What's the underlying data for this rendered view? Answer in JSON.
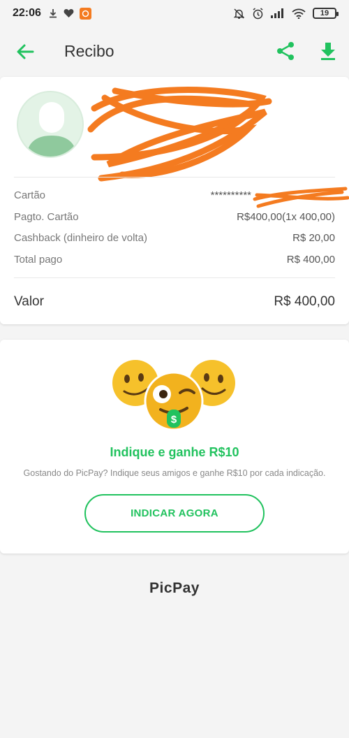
{
  "status_bar": {
    "time": "22:06",
    "battery": "19",
    "left_icons": [
      "download-icon",
      "heart-icon",
      "app-notification-icon"
    ],
    "right_icons": [
      "bell-off-icon",
      "alarm-icon",
      "signal-icon",
      "wifi-icon",
      "battery-icon"
    ]
  },
  "app_bar": {
    "title": "Recibo",
    "accent_color": "#21c25e"
  },
  "receipt": {
    "rows": [
      {
        "label": "Cartão",
        "value": "**********"
      },
      {
        "label": "Pagto. Cartão",
        "value": "R$400,00(1x 400,00)"
      },
      {
        "label": "Cashback (dinheiro de volta)",
        "value": "R$ 20,00"
      },
      {
        "label": "Total pago",
        "value": "R$ 400,00"
      }
    ],
    "total_label": "Valor",
    "total_value": "R$ 400,00"
  },
  "promo": {
    "title": "Indique e ganhe R$10",
    "subtitle": "Gostando do PicPay? Indique seus amigos e ganhe R$10 por cada indicação.",
    "button_label": "INDICAR AGORA",
    "emoji_tongue_symbol": "$"
  },
  "brand": "PicPay"
}
